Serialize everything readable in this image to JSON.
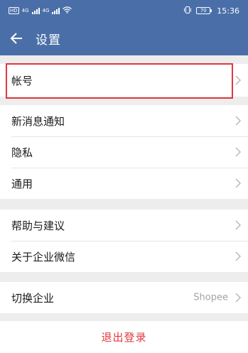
{
  "status_bar": {
    "network_label": "HD",
    "net1": "4G",
    "net2": "4G",
    "battery": "70",
    "time": "15:36"
  },
  "header": {
    "title": "设置"
  },
  "groups": [
    {
      "items": [
        {
          "label": "帐号"
        }
      ]
    },
    {
      "items": [
        {
          "label": "新消息通知"
        },
        {
          "label": "隐私"
        },
        {
          "label": "通用"
        }
      ]
    },
    {
      "items": [
        {
          "label": "帮助与建议"
        },
        {
          "label": "关于企业微信"
        }
      ]
    },
    {
      "items": [
        {
          "label": "切换企业",
          "value": "Shopee"
        }
      ]
    }
  ],
  "logout": {
    "label": "退出登录"
  },
  "colors": {
    "header_bg": "#4a6fa8",
    "danger": "#e0383e",
    "page_bg": "#ededed"
  },
  "icons": {
    "back": "arrow-left-icon",
    "chevron": "chevron-right-icon"
  }
}
